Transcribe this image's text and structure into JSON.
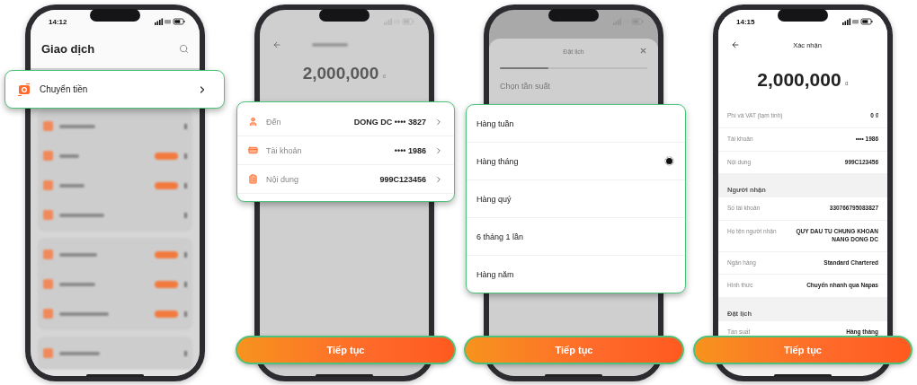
{
  "phones": [
    {
      "kind": "menu",
      "status_time": "14:12",
      "title": "Giao dịch",
      "highlight_item": {
        "label": "Chuyển tiền"
      }
    },
    {
      "kind": "transfer",
      "amount": "2,000,000",
      "currency": "₫",
      "fields": [
        {
          "label": "Đến",
          "value": "DONG DC •••• 3827"
        },
        {
          "label": "Tài khoản",
          "value": "•••• 1986"
        },
        {
          "label": "Nội dung",
          "value": "999C123456"
        }
      ],
      "button": "Tiếp tục"
    },
    {
      "kind": "schedule",
      "title": "Đặt lịch",
      "progress": {
        "level": 0.33
      },
      "prompt": "Chọn tần suất",
      "options": [
        {
          "label": "Hàng tuần",
          "selected": false
        },
        {
          "label": "Hàng tháng",
          "selected": true
        },
        {
          "label": "Hàng quý",
          "selected": false
        },
        {
          "label": "6 tháng 1 lần",
          "selected": false
        },
        {
          "label": "Hàng năm",
          "selected": false
        }
      ],
      "button": "Tiếp tục"
    },
    {
      "kind": "confirm",
      "status_time": "14:15",
      "title": "Xác nhận",
      "amount": "2,000,000",
      "currency": "₫",
      "sections": [
        {
          "rows": [
            {
              "label": "Phí và VAT (tạm tính)",
              "value": "0 ₫"
            },
            {
              "label": "Tài khoản",
              "value": "•••• 1986"
            },
            {
              "label": "Nội dung",
              "value": "999C123456"
            }
          ]
        },
        {
          "heading": "Người nhận",
          "rows": [
            {
              "label": "Số tài khoản",
              "value": "330766795083827"
            },
            {
              "label": "Họ tên người nhận",
              "value": "QUY DAU TU CHUNG KHOAN NANG DONG DC"
            },
            {
              "label": "Ngân hàng",
              "value": "Standard Chartered"
            },
            {
              "label": "Hình thức",
              "value": "Chuyển nhanh qua Napas"
            }
          ]
        },
        {
          "heading": "Đặt lịch",
          "rows": [
            {
              "label": "Tần suất",
              "value": "Hàng tháng"
            }
          ]
        }
      ],
      "button": "Tiếp tục"
    }
  ]
}
